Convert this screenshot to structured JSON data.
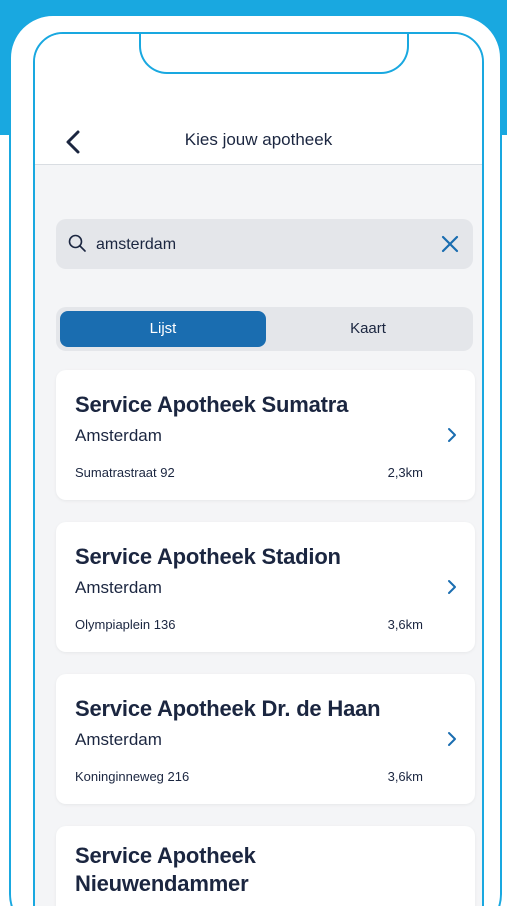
{
  "colors": {
    "accent": "#19a8e0",
    "primary": "#1a6db0",
    "text": "#1b2640",
    "background": "#f4f5f7"
  },
  "header": {
    "title": "Kies jouw apotheek",
    "back_icon": "chevron-left-icon"
  },
  "search": {
    "value": "amsterdam",
    "icon": "search-icon",
    "clear_icon": "close-icon"
  },
  "view_toggle": {
    "list_label": "Lijst",
    "map_label": "Kaart",
    "selected": "Lijst"
  },
  "results": [
    {
      "name": "Service Apotheek Sumatra",
      "city": "Amsterdam",
      "street": "Sumatrastraat 92",
      "distance": "2,3km"
    },
    {
      "name": "Service Apotheek Stadion",
      "city": "Amsterdam",
      "street": "Olympiaplein 136",
      "distance": "3,6km"
    },
    {
      "name": "Service Apotheek Dr. de Haan",
      "city": "Amsterdam",
      "street": "Koninginneweg 216",
      "distance": "3,6km"
    },
    {
      "name_line1": "Service Apotheek",
      "name_line2": "Nieuwendammer"
    }
  ]
}
